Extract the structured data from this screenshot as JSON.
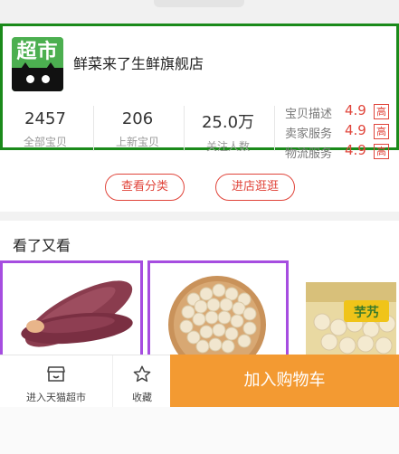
{
  "shop": {
    "logo_text": "超市",
    "name": "鲜菜来了生鲜旗舰店",
    "stats": [
      {
        "value": "2457",
        "label": "全部宝贝"
      },
      {
        "value": "206",
        "label": "上新宝贝"
      },
      {
        "value": "25.0万",
        "label": "关注人数"
      }
    ],
    "ratings": [
      {
        "label": "宝贝描述",
        "score": "4.9",
        "tag": "高"
      },
      {
        "label": "卖家服务",
        "score": "4.9",
        "tag": "高"
      },
      {
        "label": "物流服务",
        "score": "4.9",
        "tag": "高"
      }
    ]
  },
  "actions": {
    "view_category": "查看分类",
    "visit_store": "进店逛逛"
  },
  "recommend": {
    "title": "看了又看",
    "bag_label": "芋艿"
  },
  "bottom_bar": {
    "market": "进入天猫超市",
    "favorite": "收藏",
    "add_to_cart": "加入购物车"
  },
  "colors": {
    "accent_red": "#e0443a",
    "cart_orange": "#f39a32",
    "highlight_green": "#1a8a1a",
    "highlight_purple": "#a64de0"
  }
}
